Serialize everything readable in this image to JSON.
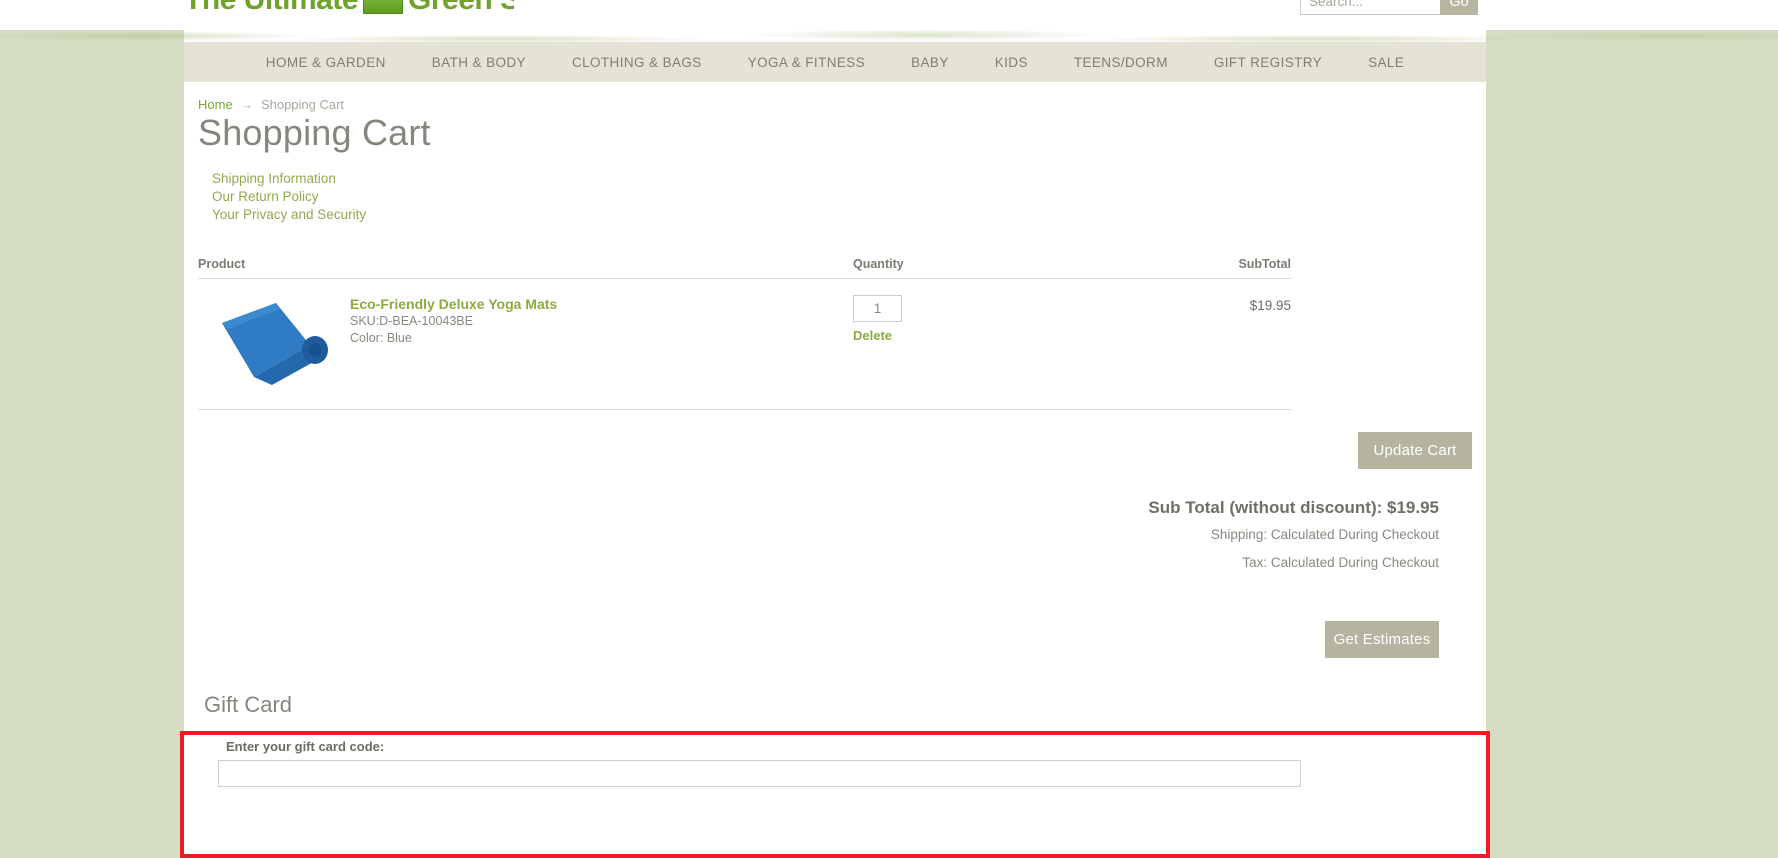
{
  "brand": {
    "logo_text_left": "The Ultimate",
    "logo_text_right": "Green Store",
    "logo_icon": "green-box-icon",
    "accent_green": "#8bab3e",
    "beige_button": "#b4b4a1",
    "page_bg": "#d5ddc3",
    "highlight_red": "#ef1c24"
  },
  "search": {
    "placeholder": "Search...",
    "value": "",
    "go_label": "Go"
  },
  "nav": {
    "items": [
      {
        "label": "HOME & GARDEN"
      },
      {
        "label": "BATH & BODY"
      },
      {
        "label": "CLOTHING & BAGS"
      },
      {
        "label": "YOGA & FITNESS"
      },
      {
        "label": "BABY"
      },
      {
        "label": "KIDS"
      },
      {
        "label": "TEENS/DORM"
      },
      {
        "label": "GIFT REGISTRY"
      },
      {
        "label": "SALE"
      }
    ]
  },
  "breadcrumb": {
    "home": "Home",
    "separator": "→",
    "current": "Shopping Cart"
  },
  "page": {
    "title": "Shopping Cart"
  },
  "policy_links": [
    {
      "label": "Shipping Information"
    },
    {
      "label": "Our Return Policy"
    },
    {
      "label": "Your Privacy and Security"
    }
  ],
  "cart": {
    "headers": {
      "product": "Product",
      "quantity": "Quantity",
      "subtotal": "SubTotal"
    },
    "items": [
      {
        "name": "Eco-Friendly Deluxe Yoga Mats",
        "sku": "SKU:D-BEA-10043BE",
        "color": "Color: Blue",
        "quantity": "1",
        "delete_label": "Delete",
        "subtotal": "$19.95",
        "thumb_icon": "blue-yoga-mat-image"
      }
    ],
    "update_cart_label": "Update Cart"
  },
  "totals": {
    "sub_total": "Sub Total (without discount): $19.95",
    "shipping": "Shipping: Calculated During Checkout",
    "tax": "Tax: Calculated During Checkout",
    "get_estimates_label": "Get Estimates"
  },
  "gift_card": {
    "title": "Gift Card",
    "label": "Enter your gift card code:",
    "input_value": "",
    "input_placeholder": ""
  }
}
